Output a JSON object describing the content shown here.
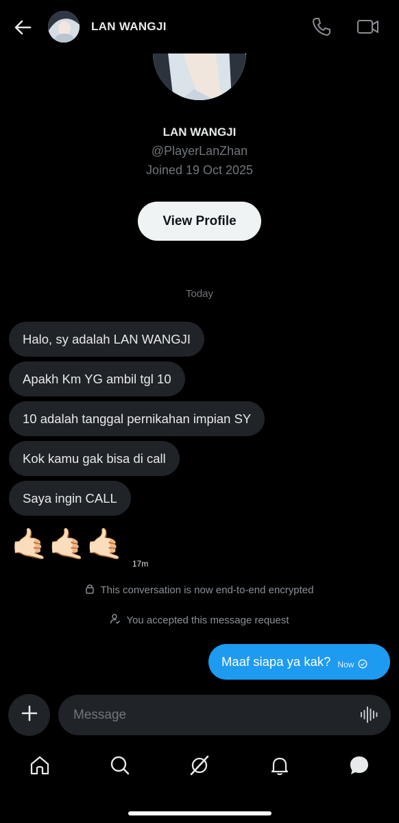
{
  "header": {
    "back_icon": "arrow-left-icon",
    "name": "LAN WANGJI",
    "call_icon": "phone-icon",
    "video_icon": "video-camera-icon"
  },
  "profile": {
    "name": "LAN WANGJI",
    "handle": "@PlayerLanZhan",
    "joined": "Joined 19 Oct 2025",
    "view_button": "View Profile"
  },
  "conversation": {
    "day_label": "Today",
    "incoming": [
      {
        "text": "Halo, sy adalah LAN WANGJI"
      },
      {
        "text": "Apakh Km YG ambil tgl 10"
      },
      {
        "text": "10 adalah tanggal pernikahan impian SY"
      },
      {
        "text": "Kok kamu gak bisa di call"
      },
      {
        "text": "Saya ingin CALL"
      }
    ],
    "emoji_message": "🤙🏻🤙🏻🤙🏻",
    "emoji_time": "17m",
    "encrypted_notice": "This conversation is now end-to-end encrypted",
    "accepted_notice": "You accepted this message request",
    "outgoing": {
      "text": "Maaf siapa ya kak?",
      "time": "Now",
      "status_icon": "check-circle-icon"
    }
  },
  "composer": {
    "placeholder": "Message",
    "add_icon": "plus-icon",
    "voice_icon": "voice-wave-icon"
  },
  "nav": {
    "items": [
      "home-icon",
      "search-icon",
      "grok-icon",
      "bell-icon",
      "messages-icon"
    ]
  },
  "colors": {
    "accent": "#1d9bf0",
    "bubble": "#202327",
    "background": "#000000"
  }
}
